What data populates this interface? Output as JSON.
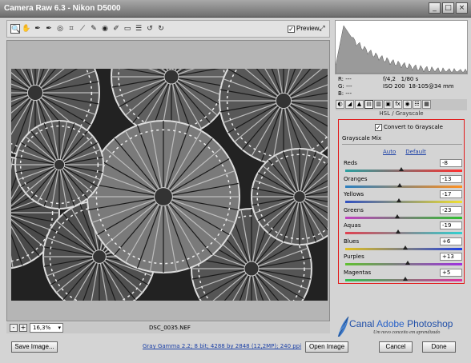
{
  "window": {
    "title": "Camera Raw 6.3  -  Nikon D5000",
    "controls": [
      "_",
      "□",
      "×"
    ]
  },
  "toolbar": {
    "tools": [
      "zoom-icon",
      "hand-icon",
      "white-balance-icon",
      "color-sampler-icon",
      "target-adjust-icon",
      "crop-icon",
      "straighten-icon",
      "spot-removal-icon",
      "red-eye-icon",
      "adjustment-brush-icon",
      "graduated-filter-icon",
      "preferences-icon",
      "rotate-ccw-icon",
      "rotate-cw-icon"
    ],
    "tool_glyphs": [
      "🔍",
      "✋",
      "✒",
      "✒",
      "◎",
      "⌗",
      "⟋",
      "✎",
      "◉",
      "✐",
      "▭",
      "☰",
      "↺",
      "↻"
    ],
    "preview_label": "Preview",
    "preview_checked": true
  },
  "status": {
    "zoom_minus": "-",
    "zoom_plus": "+",
    "zoom_value": "16,3%",
    "filename": "DSC_0035.NEF"
  },
  "readout": {
    "r": "R:   ---",
    "g": "G:   ---",
    "b": "B:   ---",
    "aperture": "f/4,2",
    "shutter": "1/80 s",
    "iso": "ISO 200",
    "lens": "18-105@34 mm"
  },
  "panel": {
    "title": "HSL / Grayscale",
    "convert_label": "Convert to Grayscale",
    "convert_checked": true,
    "mix_tab": "Grayscale Mix",
    "auto_link": "Auto",
    "default_link": "Default",
    "sliders": [
      {
        "label": "Reds",
        "value": "-8",
        "level": -8
      },
      {
        "label": "Oranges",
        "value": "-13",
        "level": -13
      },
      {
        "label": "Yellows",
        "value": "-17",
        "level": -17
      },
      {
        "label": "Greens",
        "value": "-23",
        "level": -23
      },
      {
        "label": "Aquas",
        "value": "-19",
        "level": -19
      },
      {
        "label": "Blues",
        "value": "+6",
        "level": 6
      },
      {
        "label": "Purples",
        "value": "+13",
        "level": 13
      },
      {
        "label": "Magentas",
        "value": "+5",
        "level": 5
      }
    ],
    "slider_range": [
      -200,
      200
    ]
  },
  "logo": {
    "canal": "Canal ",
    "adobe": "Adobe ",
    "photoshop": "Photoshop",
    "tagline": "Um novo conceito em aprendizado"
  },
  "bottom": {
    "save_label": "Save Image...",
    "workflow_link": "Gray Gamma 2.2; 8 bit; 4288 by 2848 (12,2MP); 240 ppi",
    "open_label": "Open Image",
    "cancel_label": "Cancel",
    "done_label": "Done"
  },
  "colors": {
    "accent_red": "#e21a1a",
    "link_blue": "#1a3fa6"
  }
}
